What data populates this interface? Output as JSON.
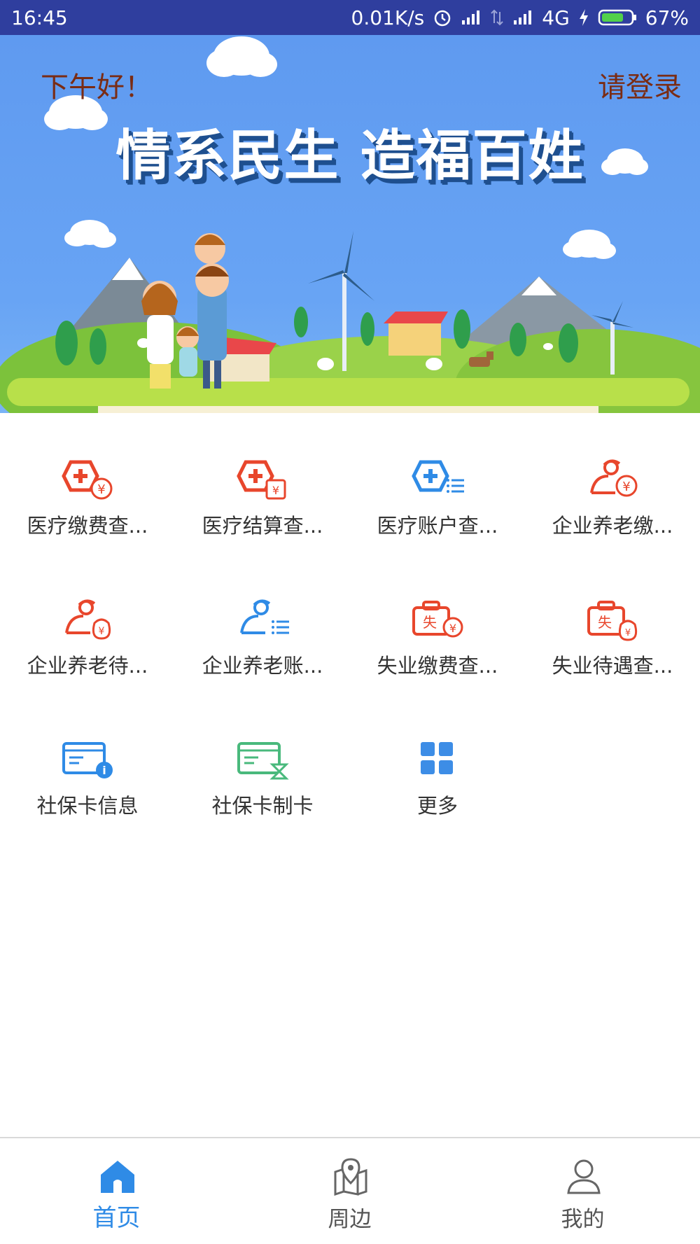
{
  "status_bar": {
    "time": "16:45",
    "speed": "0.01K/s",
    "network": "4G",
    "battery": "67%"
  },
  "banner": {
    "greeting": "下午好！",
    "login": "请登录",
    "slogan": "情系民生 造福百姓"
  },
  "services": [
    {
      "label": "医疗缴费查...",
      "icon": "medical-payment-icon"
    },
    {
      "label": "医疗结算查...",
      "icon": "medical-settlement-icon"
    },
    {
      "label": "医疗账户查...",
      "icon": "medical-account-icon"
    },
    {
      "label": "企业养老缴...",
      "icon": "pension-payment-icon"
    },
    {
      "label": "企业养老待...",
      "icon": "pension-benefit-icon"
    },
    {
      "label": "企业养老账...",
      "icon": "pension-account-icon"
    },
    {
      "label": "失业缴费查...",
      "icon": "unemployment-payment-icon"
    },
    {
      "label": "失业待遇查...",
      "icon": "unemployment-benefit-icon"
    },
    {
      "label": "社保卡信息",
      "icon": "social-card-info-icon"
    },
    {
      "label": "社保卡制卡",
      "icon": "social-card-making-icon"
    },
    {
      "label": "更多",
      "icon": "more-grid-icon"
    }
  ],
  "tabs": [
    {
      "label": "首页",
      "icon": "home-icon",
      "active": true
    },
    {
      "label": "周边",
      "icon": "map-pin-icon",
      "active": false
    },
    {
      "label": "我的",
      "icon": "user-icon",
      "active": false
    }
  ],
  "colors": {
    "status_bar": "#2f3e9e",
    "banner_sky": "#5f9af0",
    "red_icon": "#e8462c",
    "blue_icon": "#2f8be6",
    "green_icon": "#49b97c",
    "active_tab": "#2f8be6"
  }
}
